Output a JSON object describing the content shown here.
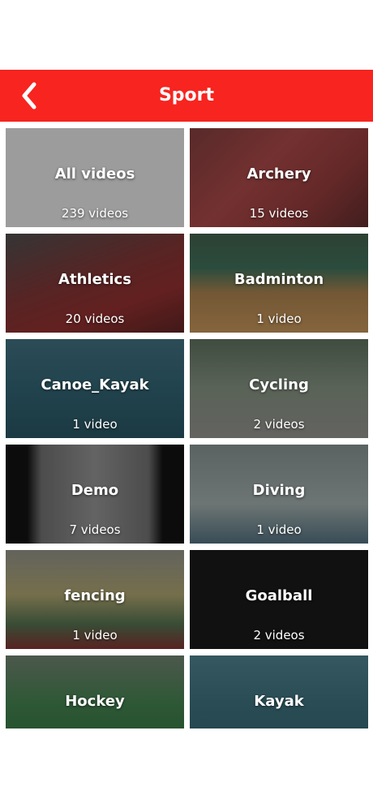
{
  "header": {
    "title": "Sport"
  },
  "categories": [
    {
      "name": "All videos",
      "count": "239 videos",
      "theme": "gray"
    },
    {
      "name": "Archery",
      "count": "15 videos",
      "theme": "track"
    },
    {
      "name": "Athletics",
      "count": "20 videos",
      "theme": "stadium"
    },
    {
      "name": "Badminton",
      "count": "1 video",
      "theme": "court"
    },
    {
      "name": "Canoe_Kayak",
      "count": "1 video",
      "theme": "water"
    },
    {
      "name": "Cycling",
      "count": "2 videos",
      "theme": "cycling"
    },
    {
      "name": "Demo",
      "count": "7 videos",
      "theme": "gym"
    },
    {
      "name": "Diving",
      "count": "1 video",
      "theme": "hall"
    },
    {
      "name": "fencing",
      "count": "1 video",
      "theme": "indoor"
    },
    {
      "name": "Goalball",
      "count": "2 videos",
      "theme": "black"
    },
    {
      "name": "Hockey",
      "count": "",
      "theme": "field"
    },
    {
      "name": "Kayak",
      "count": "",
      "theme": "water"
    }
  ]
}
